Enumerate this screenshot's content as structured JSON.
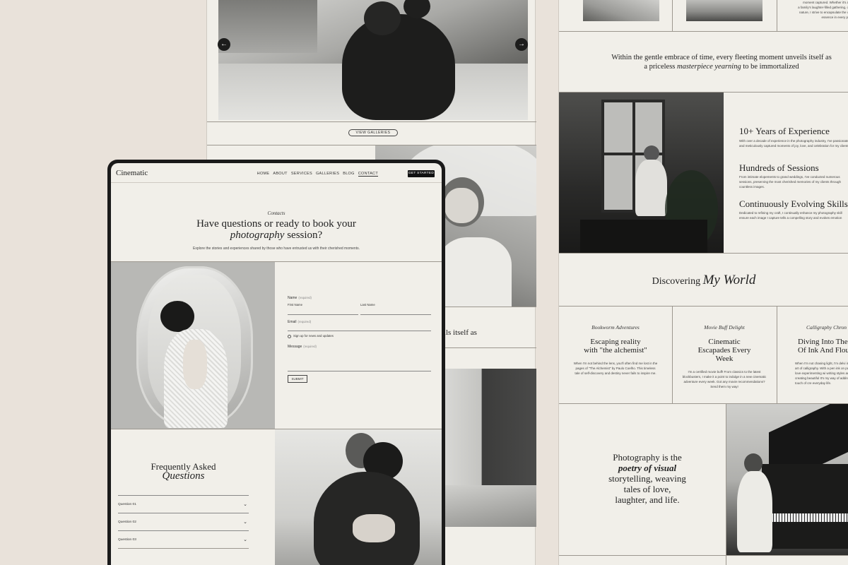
{
  "back_left": {
    "view_galleries": "VIEW GALLERIES",
    "partial_quote": "eils itself as"
  },
  "back_right": {
    "top_text": "moment captured. Whether it's a\na family's laughter-filled gathering, o\nnature, I strive to encapsulate the v\nessence in every pi",
    "quote_line1": "Within the gentle embrace of time, every fleeting moment unveils itself as",
    "quote_line2_pre": "a priceless ",
    "quote_line2_em": "masterpiece yearning",
    "quote_line2_post": " to be immortalized",
    "experience": [
      {
        "title": "10+ Years of Experience",
        "body": "With over a decade of experience in the photography industry, I've passionately and meticulously captured moments of joy, love, and celebration for my clients."
      },
      {
        "title": "Hundreds of Sessions",
        "body": "From intimate elopements to grand weddings, I've conducted numerous sessions, preserving the most cherished memories of my clients through countless images."
      },
      {
        "title": "Continuously Evolving Skills",
        "body": "Dedicated to refining my craft, I continually enhance my photography skill ensure each image I capture tells a compelling story and evokes emotion"
      }
    ],
    "discovering": "Discovering ",
    "discovering_em": "My World",
    "cards": [
      {
        "script": "Bookworm Adventures",
        "title": "Escaping reality with \"the alchemist\"",
        "body": "When I'm not behind the lens, you'll often find me lost in the pages of \"The Alchemist\" by Paulo Coelho. This timeless tale of self-discovery and destiny never fails to inspire me."
      },
      {
        "script": "Movie Buff Delight",
        "title": "Cinematic Escapades Every Week",
        "body": "I'm a certified movie buff! From classics to the latest blockbusters, I make it a point to indulge in a new cinematic adventure every week. Got any movie recommendations? Send them my way!"
      },
      {
        "script": "Calligraphy Chron",
        "title": "Diving Into The W Of Ink And Flouri",
        "body": "When I'm not chasing light, I'm delvi intricate art of calligraphy. With a pen ink on paper, I love experimenting wi writing styles and creating beautiful It's my way of adding a touch of cre everyday life."
      }
    ],
    "poetry_1": "Photography is the",
    "poetry_em": "poetry of visual",
    "poetry_2": "storytelling, weaving",
    "poetry_3": "tales of love,",
    "poetry_4": "laughter, and life."
  },
  "tablet": {
    "logo": "Cinematic",
    "nav": [
      "HOME",
      "ABOUT",
      "SERVICES",
      "GALLERIES",
      "BLOG",
      "CONTACT"
    ],
    "active_nav": "CONTACT",
    "cta": "GET STARTED",
    "contact_script": "Contacts",
    "headline_1": "Have questions or ready to book your",
    "headline_em": "photography",
    "headline_2": " session?",
    "subtext": "Explore the stories and experiences shared by those who have entrusted us with their cherished moments.",
    "form": {
      "name_label": "Name",
      "required": "(required)",
      "first_name": "First Name",
      "last_name": "Last Name",
      "email_label": "Email",
      "signup": "Sign up for news and updates",
      "message_label": "Message",
      "submit": "SUBMIT"
    },
    "faq_1": "Frequently Asked",
    "faq_2": "Questions",
    "questions": [
      "Question 01",
      "Question 02",
      "Question 03"
    ]
  },
  "icons": {
    "prev": "arrow-left-icon",
    "next": "arrow-right-icon",
    "expand": "chevron-down-icon"
  },
  "colors": {
    "background": "#e9e2da",
    "page": "#f1efe9",
    "ink": "#111111"
  }
}
